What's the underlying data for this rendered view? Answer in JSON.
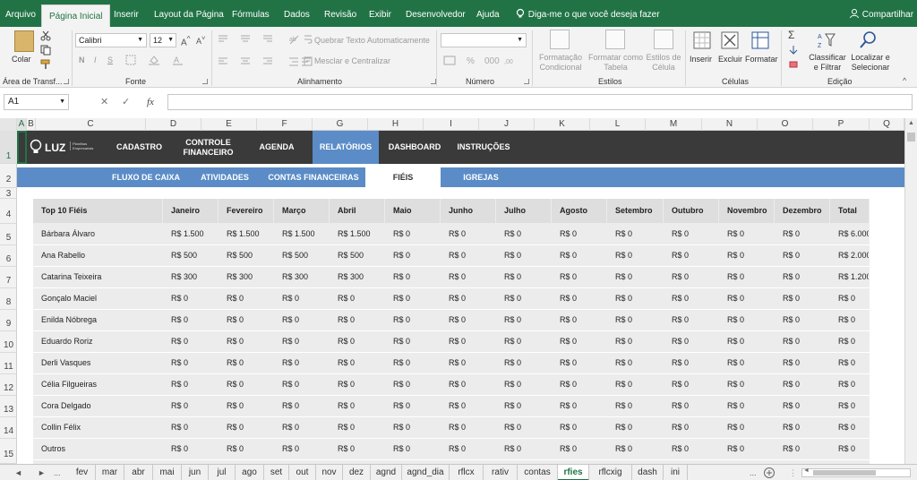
{
  "ribbon_tabs": [
    "Arquivo",
    "Página Inicial",
    "Inserir",
    "Layout da Página",
    "Fórmulas",
    "Dados",
    "Revisão",
    "Exibir",
    "Desenvolvedor",
    "Ajuda"
  ],
  "active_ribbon_tab": "Página Inicial",
  "tell_me": "Diga-me o que você deseja fazer",
  "share": "Compartilhar",
  "ribbon": {
    "paste": "Colar",
    "clipboard": "Área de Transf...",
    "font_name": "Calibri",
    "font_size": "12",
    "font_group": "Fonte",
    "bold": "N",
    "italic": "I",
    "underline": "S",
    "wrap_text": "Quebrar Texto Automaticamente",
    "merge_center": "Mesclar e Centralizar",
    "alignment_group": "Alinhamento",
    "number_group": "Número",
    "cond_format": "Formatação Condicional",
    "format_table": "Formatar como Tabela",
    "cell_styles": "Estilos de Célula",
    "styles_group": "Estilos",
    "insert": "Inserir",
    "delete": "Excluir",
    "format": "Formatar",
    "cells_group": "Células",
    "sort_filter": "Classificar e Filtrar",
    "find_select": "Localizar e Selecionar",
    "editing_group": "Edição"
  },
  "name_box": "A1",
  "fx": "fx",
  "columns": [
    "A",
    "B",
    "C",
    "D",
    "E",
    "F",
    "G",
    "H",
    "I",
    "J",
    "K",
    "L",
    "M",
    "N",
    "O",
    "P",
    "Q"
  ],
  "rows": [
    "1",
    "2",
    "3",
    "4",
    "5",
    "6",
    "7",
    "8",
    "9",
    "10",
    "11",
    "12",
    "13",
    "14",
    "15"
  ],
  "top_nav": {
    "logo_text": "LUZ",
    "logo_sub": "Planilhas Empresariais",
    "items": [
      "CADASTRO",
      "CONTROLE FINANCEIRO",
      "AGENDA",
      "RELATÓRIOS",
      "DASHBOARD",
      "INSTRUÇÕES"
    ],
    "active": "RELATÓRIOS"
  },
  "sub_nav": {
    "items": [
      "FLUXO DE CAIXA",
      "ATIVIDADES",
      "CONTAS FINANCEIRAS",
      "FIÉIS",
      "IGREJAS"
    ],
    "active": "FIÉIS"
  },
  "table": {
    "headers": [
      "Top 10 Fiéis",
      "Janeiro",
      "Fevereiro",
      "Março",
      "Abril",
      "Maio",
      "Junho",
      "Julho",
      "Agosto",
      "Setembro",
      "Outubro",
      "Novembro",
      "Dezembro",
      "Total"
    ],
    "rows": [
      [
        "Bárbara Álvaro",
        "R$ 1.500",
        "R$ 1.500",
        "R$ 1.500",
        "R$ 1.500",
        "R$ 0",
        "R$ 0",
        "R$ 0",
        "R$ 0",
        "R$ 0",
        "R$ 0",
        "R$ 0",
        "R$ 0",
        "R$ 6.000"
      ],
      [
        "Ana Rabello",
        "R$ 500",
        "R$ 500",
        "R$ 500",
        "R$ 500",
        "R$ 0",
        "R$ 0",
        "R$ 0",
        "R$ 0",
        "R$ 0",
        "R$ 0",
        "R$ 0",
        "R$ 0",
        "R$ 2.000"
      ],
      [
        "Catarina Teixeira",
        "R$ 300",
        "R$ 300",
        "R$ 300",
        "R$ 300",
        "R$ 0",
        "R$ 0",
        "R$ 0",
        "R$ 0",
        "R$ 0",
        "R$ 0",
        "R$ 0",
        "R$ 0",
        "R$ 1.200"
      ],
      [
        "Gonçalo Maciel",
        "R$ 0",
        "R$ 0",
        "R$ 0",
        "R$ 0",
        "R$ 0",
        "R$ 0",
        "R$ 0",
        "R$ 0",
        "R$ 0",
        "R$ 0",
        "R$ 0",
        "R$ 0",
        "R$ 0"
      ],
      [
        "Enilda Nóbrega",
        "R$ 0",
        "R$ 0",
        "R$ 0",
        "R$ 0",
        "R$ 0",
        "R$ 0",
        "R$ 0",
        "R$ 0",
        "R$ 0",
        "R$ 0",
        "R$ 0",
        "R$ 0",
        "R$ 0"
      ],
      [
        "Eduardo Roriz",
        "R$ 0",
        "R$ 0",
        "R$ 0",
        "R$ 0",
        "R$ 0",
        "R$ 0",
        "R$ 0",
        "R$ 0",
        "R$ 0",
        "R$ 0",
        "R$ 0",
        "R$ 0",
        "R$ 0"
      ],
      [
        "Derli Vasques",
        "R$ 0",
        "R$ 0",
        "R$ 0",
        "R$ 0",
        "R$ 0",
        "R$ 0",
        "R$ 0",
        "R$ 0",
        "R$ 0",
        "R$ 0",
        "R$ 0",
        "R$ 0",
        "R$ 0"
      ],
      [
        "Célia Filgueiras",
        "R$ 0",
        "R$ 0",
        "R$ 0",
        "R$ 0",
        "R$ 0",
        "R$ 0",
        "R$ 0",
        "R$ 0",
        "R$ 0",
        "R$ 0",
        "R$ 0",
        "R$ 0",
        "R$ 0"
      ],
      [
        "Cora Delgado",
        "R$ 0",
        "R$ 0",
        "R$ 0",
        "R$ 0",
        "R$ 0",
        "R$ 0",
        "R$ 0",
        "R$ 0",
        "R$ 0",
        "R$ 0",
        "R$ 0",
        "R$ 0",
        "R$ 0"
      ],
      [
        "Collin Félix",
        "R$ 0",
        "R$ 0",
        "R$ 0",
        "R$ 0",
        "R$ 0",
        "R$ 0",
        "R$ 0",
        "R$ 0",
        "R$ 0",
        "R$ 0",
        "R$ 0",
        "R$ 0",
        "R$ 0"
      ],
      [
        "Outros",
        "R$ 0",
        "R$ 0",
        "R$ 0",
        "R$ 0",
        "R$ 0",
        "R$ 0",
        "R$ 0",
        "R$ 0",
        "R$ 0",
        "R$ 0",
        "R$ 0",
        "R$ 0",
        "R$ 0"
      ]
    ]
  },
  "sheet_tabs": [
    "fev",
    "mar",
    "abr",
    "mai",
    "jun",
    "jul",
    "ago",
    "set",
    "out",
    "nov",
    "dez",
    "agnd",
    "agnd_dia",
    "rflcx",
    "rativ",
    "contas",
    "rfies",
    "rflcxig",
    "dash",
    "ini"
  ],
  "active_sheet": "rfies",
  "colors": {
    "excel_green": "#217346",
    "nav_dark": "#3a3a3a",
    "nav_blue": "#5b8cc7",
    "table_bg": "#ececec",
    "table_header": "#dedede"
  }
}
